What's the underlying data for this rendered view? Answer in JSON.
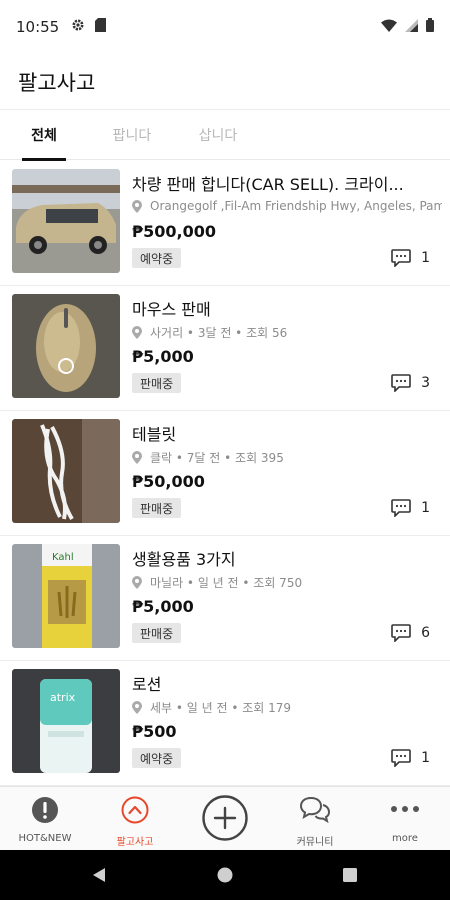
{
  "status_bar": {
    "time": "10:55"
  },
  "app_bar": {
    "title": "팔고사고"
  },
  "tabs": [
    {
      "label": "전체",
      "active": true
    },
    {
      "label": "팝니다",
      "active": false
    },
    {
      "label": "삽니다",
      "active": false
    }
  ],
  "listings": [
    {
      "title": "차량 판매 합니다(CAR SELL). 크라이...",
      "meta": "Orangegolf ,Fil-Am Friendship Hwy, Angeles, Pam...",
      "price": "₱500,000",
      "status": "예약중",
      "comments": "1",
      "image": "car"
    },
    {
      "title": "마우스 판매",
      "meta": "사거리 • 3달 전 • 조회 56",
      "price": "₱5,000",
      "status": "판매중",
      "comments": "3",
      "image": "mouse"
    },
    {
      "title": "테블릿",
      "meta": "클락 • 7달 전 • 조회 395",
      "price": "₱50,000",
      "status": "판매중",
      "comments": "1",
      "image": "cable"
    },
    {
      "title": "생활용품 3가지",
      "meta": "마닐라 • 일 년 전 • 조회 750",
      "price": "₱5,000",
      "status": "판매중",
      "comments": "6",
      "image": "cream"
    },
    {
      "title": "로션",
      "meta": "세부 • 일 년 전 • 조회 179",
      "price": "₱500",
      "status": "예약중",
      "comments": "1",
      "image": "lotion"
    }
  ],
  "bottom_nav": [
    {
      "label": "HOT&NEW",
      "icon": "alert-circle-icon",
      "active": false
    },
    {
      "label": "팔고사고",
      "icon": "chevron-up-circle-icon",
      "active": true
    },
    {
      "label": "",
      "icon": "plus-circle-icon",
      "active": false
    },
    {
      "label": "커뮤니티",
      "icon": "chat-bubbles-icon",
      "active": false
    },
    {
      "label": "more",
      "icon": "more-dots-icon",
      "active": false
    }
  ],
  "colors": {
    "accent": "#e5482a",
    "badge_bg": "#e6e6e6",
    "text": "#111111",
    "muted": "#8c8c8c"
  }
}
